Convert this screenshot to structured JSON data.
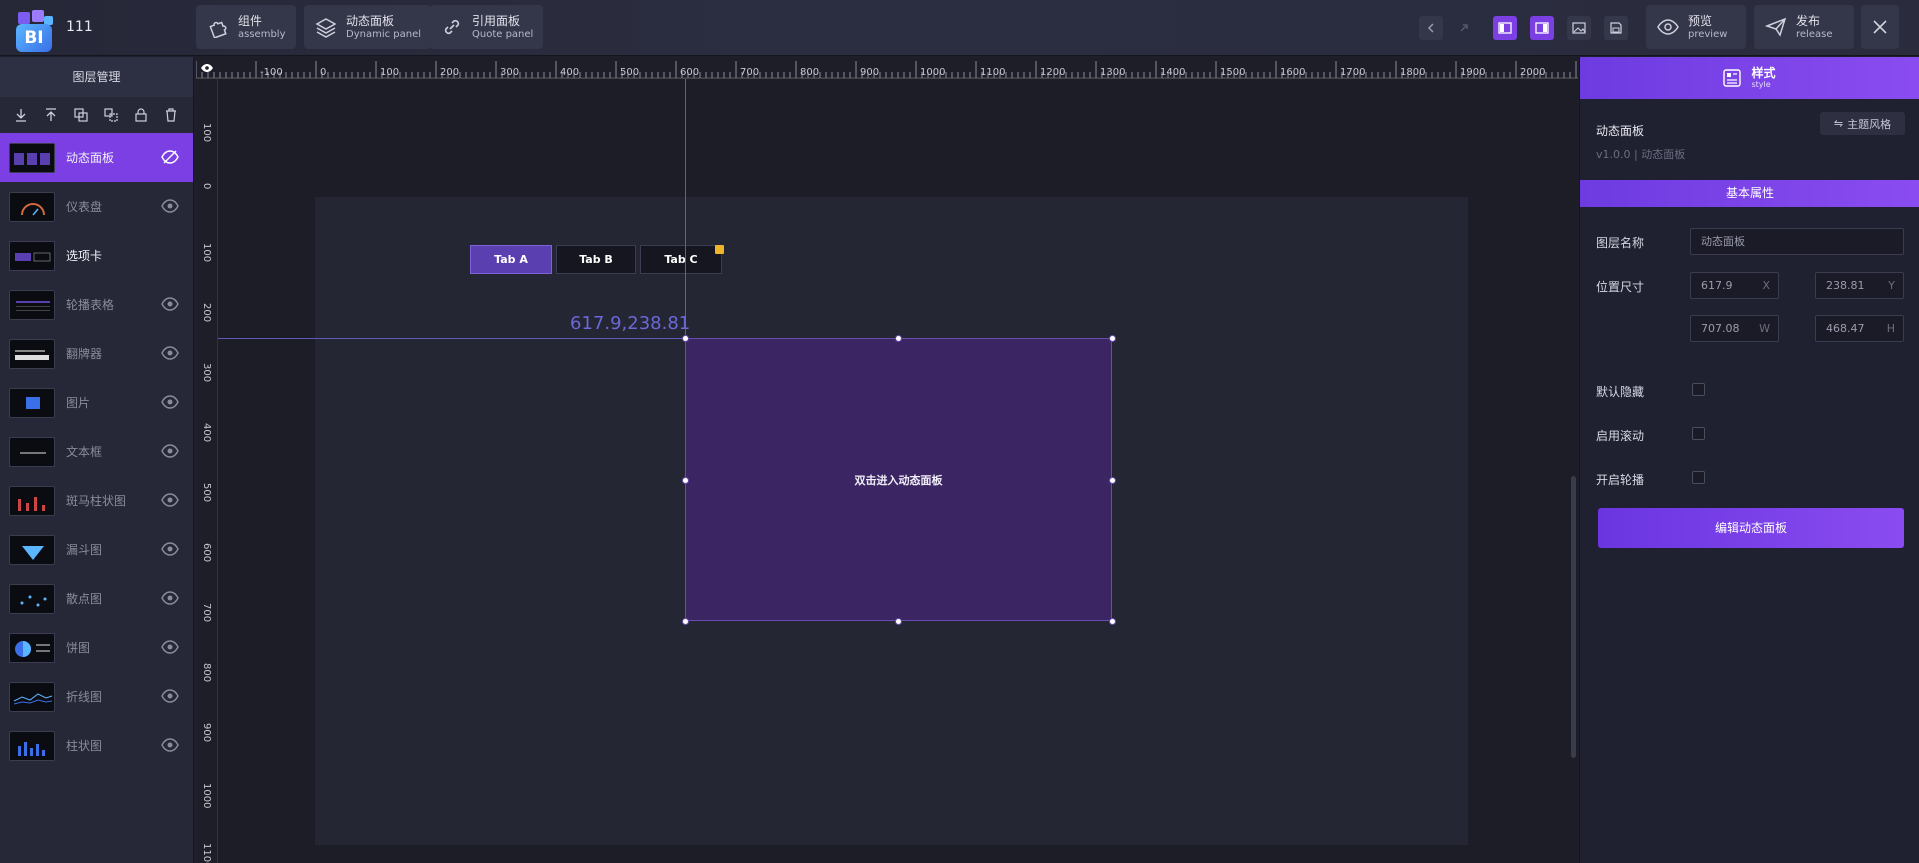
{
  "header": {
    "project_name": "111",
    "buttons": [
      {
        "label": "组件",
        "sub": "assembly"
      },
      {
        "label": "动态面板",
        "sub": "Dynamic panel"
      },
      {
        "label": "引用面板",
        "sub": "Quote panel"
      }
    ],
    "preview": {
      "label": "预览",
      "sub": "preview"
    },
    "publish": {
      "label": "发布",
      "sub": "release"
    }
  },
  "left_panel": {
    "title": "图层管理",
    "layers": [
      {
        "name": "动态面板"
      },
      {
        "name": "仪表盘"
      },
      {
        "name": "选项卡"
      },
      {
        "name": "轮播表格"
      },
      {
        "name": "翻牌器"
      },
      {
        "name": "图片"
      },
      {
        "name": "文本框"
      },
      {
        "name": "斑马柱状图"
      },
      {
        "name": "漏斗图"
      },
      {
        "name": "散点图"
      },
      {
        "name": "饼图"
      },
      {
        "name": "折线图"
      },
      {
        "name": "柱状图"
      }
    ]
  },
  "ruler": {
    "top": [
      "-100",
      "0",
      "100",
      "200",
      "300",
      "400",
      "500",
      "600",
      "700",
      "800",
      "900",
      "1000",
      "1100",
      "1200",
      "1300",
      "1400",
      "1500",
      "1600",
      "1700",
      "1800",
      "1900",
      "2000",
      "2"
    ],
    "left": [
      "100",
      "0",
      "100",
      "200",
      "300",
      "400",
      "500",
      "600",
      "700",
      "800",
      "900",
      "1000",
      "1100"
    ]
  },
  "canvas": {
    "tabs": [
      "Tab A",
      "Tab B",
      "Tab C"
    ],
    "coord_label": "617.9,238.81",
    "panel_text": "双击进入动态面板"
  },
  "right_panel": {
    "header": {
      "label": "样式",
      "sub": "style"
    },
    "component_name": "动态面板",
    "version": "v1.0.0 | 动态面板",
    "theme_button": "主题风格",
    "section_title": "基本属性",
    "fields": {
      "layer_name_label": "图层名称",
      "layer_name_placeholder": "动态面板",
      "position_size_label": "位置尺寸",
      "x": "617.9",
      "x_suffix": "X",
      "y": "238.81",
      "y_suffix": "Y",
      "w": "707.08",
      "w_suffix": "W",
      "h": "468.47",
      "h_suffix": "H",
      "default_hidden": "默认隐藏",
      "enable_scroll": "启用滚动",
      "enable_carousel": "开启轮播"
    },
    "edit_button": "编辑动态面板"
  },
  "colors": {
    "accent": "#7b3fe4",
    "panel_fill": "#3b2663"
  }
}
